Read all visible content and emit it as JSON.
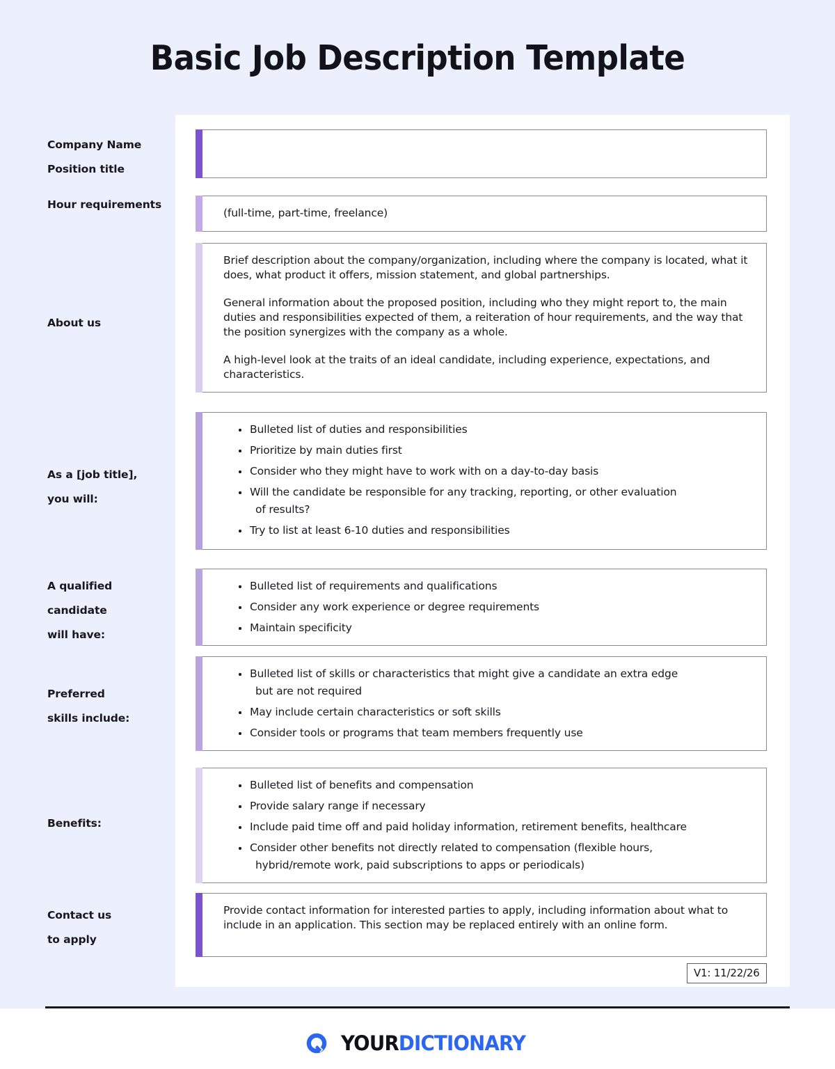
{
  "page": {
    "title": "Basic Job Description Template",
    "background_color": "#eceffc",
    "card_color": "#ffffff"
  },
  "version_stamp": "V1: 11/22/26",
  "footer": {
    "logo_mark": "yourdictionary-q-icon",
    "logo_text_primary": "YOUR",
    "logo_text_secondary": "DICTIONARY",
    "brand_color": "#2b66f0"
  },
  "sections": [
    {
      "id": "company-position",
      "label_lines": [
        "Company Name",
        "Position title"
      ],
      "accent_color": "#7b52cf",
      "content_type": "empty",
      "paragraphs": [],
      "bullets": []
    },
    {
      "id": "hour-requirements",
      "label_lines": [
        "Hour requirements"
      ],
      "accent_color": "#c3aae9",
      "content_type": "text",
      "paragraphs": [
        "(full-time, part-time, freelance)"
      ],
      "bullets": []
    },
    {
      "id": "about-us",
      "label_lines": [
        "About us"
      ],
      "accent_color": "#d9cdf0",
      "content_type": "text",
      "paragraphs": [
        "Brief description about the company/organization, including where the company is located, what it does, what product it offers, mission statement, and global partnerships.",
        "General information about the proposed position, including who they might report to, the main duties and responsibilities expected of them, a reiteration of hour requirements, and the way that the position synergizes with the company as a whole.",
        "A high-level look at the traits of an ideal candidate, including experience, expectations, and characteristics."
      ],
      "bullets": []
    },
    {
      "id": "duties",
      "label_lines": [
        "As a [job title],",
        "you will:"
      ],
      "accent_color": "#b5a0de",
      "content_type": "bullets",
      "paragraphs": [],
      "bullets": [
        {
          "text": "Bulleted list of duties and responsibilities",
          "wrap": ""
        },
        {
          "text": "Prioritize by main duties first",
          "wrap": ""
        },
        {
          "text": "Consider who they might have to work with on a day-to-day basis",
          "wrap": ""
        },
        {
          "text": "Will the candidate be responsible for any tracking, reporting, or other evaluation",
          "wrap": "of results?"
        },
        {
          "text": "Try to list at least 6-10 duties and responsibilities",
          "wrap": ""
        }
      ]
    },
    {
      "id": "qualifications",
      "label_lines": [
        "A qualified",
        "candidate",
        "will have:"
      ],
      "accent_color": "#b9a4e0",
      "content_type": "bullets",
      "paragraphs": [],
      "bullets": [
        {
          "text": "Bulleted list of requirements and qualifications",
          "wrap": ""
        },
        {
          "text": "Consider any work experience or degree requirements",
          "wrap": ""
        },
        {
          "text": "Maintain specificity",
          "wrap": ""
        }
      ]
    },
    {
      "id": "preferred-skills",
      "label_lines": [
        "Preferred",
        "skills include:"
      ],
      "accent_color": "#b9a4e0",
      "content_type": "bullets",
      "paragraphs": [],
      "bullets": [
        {
          "text": "Bulleted list of skills or characteristics that might give a candidate an extra edge",
          "wrap": "but are not required"
        },
        {
          "text": "May include certain characteristics or soft skills",
          "wrap": ""
        },
        {
          "text": "Consider tools or programs that team members frequently use",
          "wrap": ""
        }
      ]
    },
    {
      "id": "benefits",
      "label_lines": [
        "Benefits:"
      ],
      "accent_color": "#ded3f2",
      "content_type": "bullets",
      "paragraphs": [],
      "bullets": [
        {
          "text": "Bulleted list of benefits and compensation",
          "wrap": ""
        },
        {
          "text": "Provide salary range if necessary",
          "wrap": ""
        },
        {
          "text": "Include paid time off and paid holiday information, retirement benefits, healthcare",
          "wrap": ""
        },
        {
          "text": "Consider other benefits not directly related to compensation (flexible hours,",
          "wrap": "hybrid/remote work, paid subscriptions to apps or periodicals)"
        }
      ]
    },
    {
      "id": "contact",
      "label_lines": [
        "Contact us",
        "to apply"
      ],
      "accent_color": "#7b52cf",
      "content_type": "text",
      "paragraphs": [
        "Provide contact information for interested parties to apply, including information about what to include in an application. This section may be replaced entirely with an online form."
      ],
      "bullets": []
    }
  ]
}
